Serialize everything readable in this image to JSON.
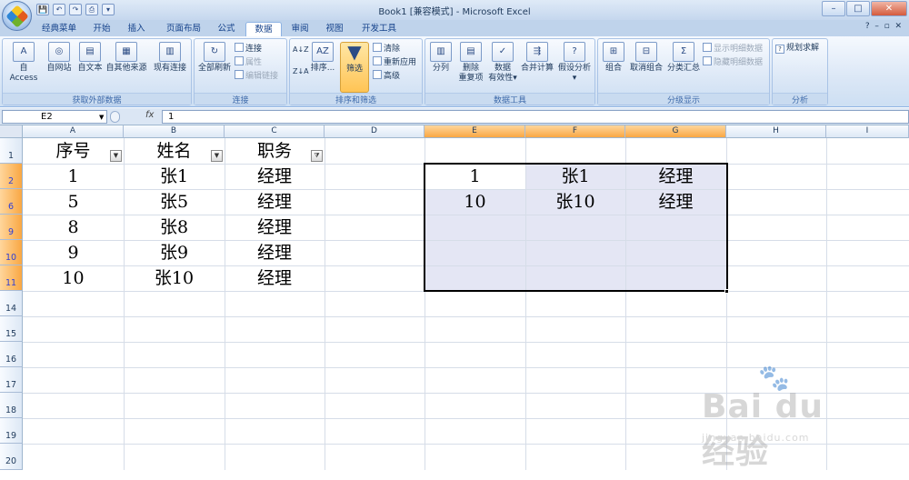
{
  "window": {
    "title": "Book1  [兼容模式] - Microsoft Excel",
    "controls": [
      "–",
      "□",
      "✕"
    ],
    "ribbon_controls": [
      "?",
      "–",
      "▫",
      "✕"
    ]
  },
  "quick_access": [
    "💾",
    "↶",
    "↷",
    "⎙",
    "▾"
  ],
  "tabs": [
    "经典菜单",
    "开始",
    "插入",
    "页面布局",
    "公式",
    "数据",
    "审阅",
    "视图",
    "开发工具"
  ],
  "active_tab": "数据",
  "ribbon": {
    "groups": [
      {
        "label": "获取外部数据",
        "buttons": [
          "自 Access",
          "自网站",
          "自文本",
          "自其他来源",
          "现有连接"
        ]
      },
      {
        "label": "连接",
        "big": "全部刷新",
        "small": [
          "连接",
          "属性",
          "编辑链接"
        ]
      },
      {
        "label": "排序和筛选",
        "sort_az": "A↓Z",
        "sort_za": "Z↓A",
        "sort": "排序...",
        "filter": "筛选",
        "small": [
          "清除",
          "重新应用",
          "高级"
        ]
      },
      {
        "label": "数据工具",
        "buttons": [
          "分列",
          "删除\n重复项",
          "数据\n有效性▾",
          "合并计算",
          "假设分析▾"
        ]
      },
      {
        "label": "分级显示",
        "buttons": [
          "组合",
          "取消组合",
          "分类汇总"
        ],
        "small": [
          "显示明细数据",
          "隐藏明细数据"
        ]
      },
      {
        "label": "分析",
        "small": [
          "规划求解"
        ]
      }
    ]
  },
  "formula_bar": {
    "name_box": "E2",
    "fx": "fx",
    "value": "1"
  },
  "columns": [
    "A",
    "B",
    "C",
    "D",
    "E",
    "F",
    "G",
    "H",
    "I"
  ],
  "selected_columns": [
    "E",
    "F",
    "G"
  ],
  "rows": [
    "1",
    "2",
    "6",
    "9",
    "10",
    "11",
    "14",
    "15",
    "16",
    "17",
    "18",
    "19",
    "20"
  ],
  "table": {
    "headers": [
      "序号",
      "姓名",
      "职务"
    ],
    "rows": [
      [
        "1",
        "张1",
        "经理"
      ],
      [
        "5",
        "张5",
        "经理"
      ],
      [
        "8",
        "张8",
        "经理"
      ],
      [
        "9",
        "张9",
        "经理"
      ],
      [
        "10",
        "张10",
        "经理"
      ]
    ]
  },
  "pasted": [
    [
      "1",
      "张1",
      "经理"
    ],
    [
      "10",
      "张10",
      "经理"
    ]
  ],
  "watermark": {
    "brand": "Bai du 经验",
    "url": "jingyan.baidu.com"
  }
}
